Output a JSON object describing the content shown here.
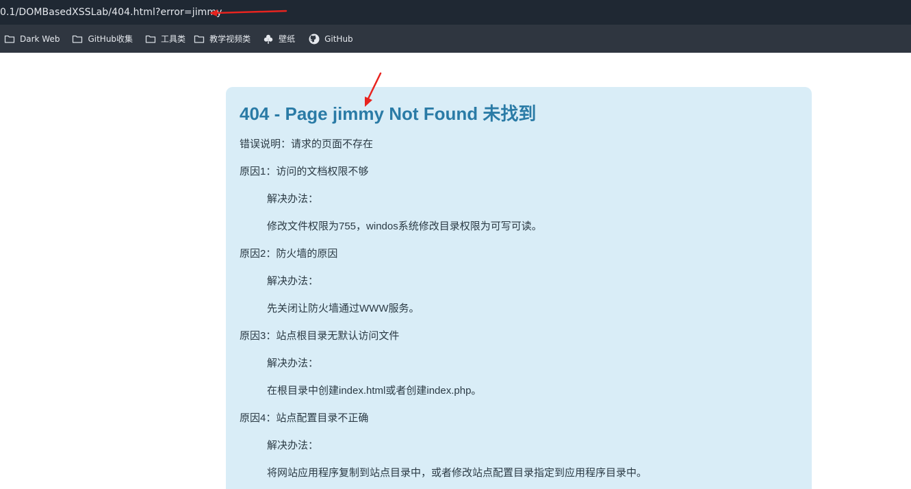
{
  "browser": {
    "url": "0.1/DOMBasedXSSLab/404.html?error=jimmy",
    "bookmarks": [
      {
        "label": "Dark Web",
        "icon": "folder-icon"
      },
      {
        "label": "GitHub收集",
        "icon": "folder-icon"
      },
      {
        "label": "工具类",
        "icon": "folder-icon"
      },
      {
        "label": "教学视频类",
        "icon": "folder-icon"
      },
      {
        "label": "壁纸",
        "icon": "clover-icon"
      },
      {
        "label": "GitHub",
        "icon": "github-icon"
      }
    ]
  },
  "page": {
    "title": "404 - Page jimmy Not Found 未找到",
    "lines": [
      "错误说明：请求的页面不存在",
      "原因1：访问的文档权限不够",
      "解决办法：",
      "修改文件权限为755，windos系统修改目录权限为可写可读。",
      "原因2：防火墙的原因",
      "解决办法：",
      "先关闭让防火墙通过WWW服务。",
      "原因3：站点根目录无默认访问文件",
      "解决办法：",
      "在根目录中创建index.html或者创建index.php。",
      "原因4：站点配置目录不正确",
      "解决办法：",
      "将网站应用程序复制到站点目录中，或者修改站点配置目录指定到应用程序目录中。"
    ]
  },
  "colors": {
    "address_bar": "#1f2833",
    "bookmarks_bar": "#2f3640",
    "panel_bg": "#d9edf7",
    "title": "#2a7ba6",
    "annotation": "#e8241f"
  }
}
